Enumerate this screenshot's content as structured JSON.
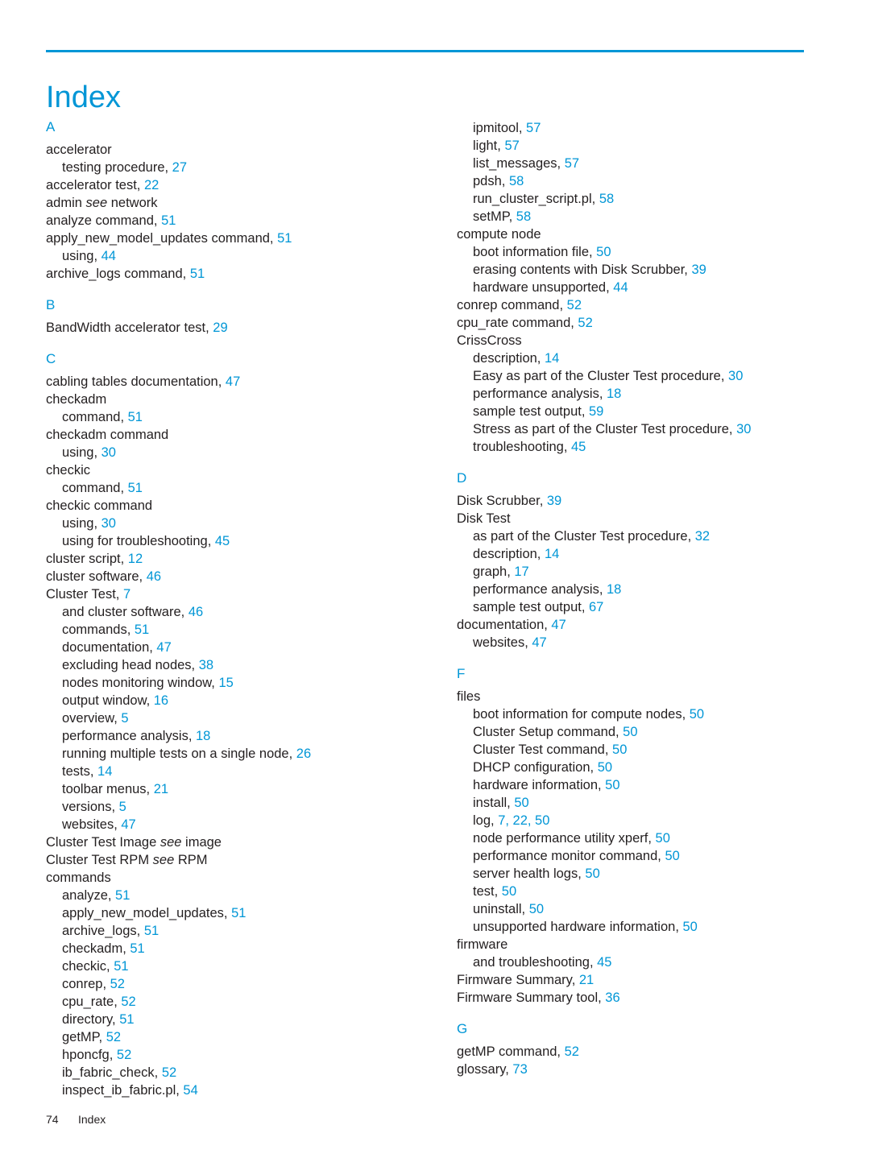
{
  "document": {
    "title": "Index",
    "footer": {
      "page_number": "74",
      "label": "Index"
    },
    "accent_color": "#0096d6",
    "text_color": "#231f20"
  },
  "columns": [
    {
      "sections": [
        {
          "letter": "A",
          "entries": [
            {
              "level": 1,
              "text": "accelerator",
              "page": ""
            },
            {
              "level": 2,
              "text": "testing procedure,",
              "page": "27"
            },
            {
              "level": 1,
              "text": "accelerator test,",
              "page": "22"
            },
            {
              "level": 1,
              "text": "admin ",
              "italic": "see",
              "text_after": " network",
              "page": ""
            },
            {
              "level": 1,
              "text": "analyze command,",
              "page": "51"
            },
            {
              "level": 1,
              "text": "apply_new_model_updates command,",
              "page": "51"
            },
            {
              "level": 2,
              "text": "using,",
              "page": "44"
            },
            {
              "level": 1,
              "text": "archive_logs command,",
              "page": "51"
            }
          ]
        },
        {
          "letter": "B",
          "entries": [
            {
              "level": 1,
              "text": "BandWidth accelerator test,",
              "page": "29"
            }
          ]
        },
        {
          "letter": "C",
          "entries": [
            {
              "level": 1,
              "text": "cabling tables documentation,",
              "page": "47"
            },
            {
              "level": 1,
              "text": "checkadm",
              "page": ""
            },
            {
              "level": 2,
              "text": "command,",
              "page": "51"
            },
            {
              "level": 1,
              "text": "checkadm command",
              "page": ""
            },
            {
              "level": 2,
              "text": "using,",
              "page": "30"
            },
            {
              "level": 1,
              "text": "checkic",
              "page": ""
            },
            {
              "level": 2,
              "text": "command,",
              "page": "51"
            },
            {
              "level": 1,
              "text": "checkic command",
              "page": ""
            },
            {
              "level": 2,
              "text": "using,",
              "page": "30"
            },
            {
              "level": 2,
              "text": "using for troubleshooting,",
              "page": "45"
            },
            {
              "level": 1,
              "text": "cluster script,",
              "page": "12"
            },
            {
              "level": 1,
              "text": "cluster software,",
              "page": "46"
            },
            {
              "level": 1,
              "text": "Cluster Test,",
              "page": "7"
            },
            {
              "level": 2,
              "text": "and cluster software,",
              "page": "46"
            },
            {
              "level": 2,
              "text": "commands,",
              "page": "51"
            },
            {
              "level": 2,
              "text": "documentation,",
              "page": "47"
            },
            {
              "level": 2,
              "text": "excluding head nodes,",
              "page": "38"
            },
            {
              "level": 2,
              "text": "nodes monitoring window,",
              "page": "15"
            },
            {
              "level": 2,
              "text": "output window,",
              "page": "16"
            },
            {
              "level": 2,
              "text": "overview,",
              "page": "5"
            },
            {
              "level": 2,
              "text": "performance analysis,",
              "page": "18"
            },
            {
              "level": 2,
              "text": "running multiple tests on a single node,",
              "page": "26"
            },
            {
              "level": 2,
              "text": "tests,",
              "page": "14"
            },
            {
              "level": 2,
              "text": "toolbar menus,",
              "page": "21"
            },
            {
              "level": 2,
              "text": "versions,",
              "page": "5"
            },
            {
              "level": 2,
              "text": "websites,",
              "page": "47"
            },
            {
              "level": 1,
              "text": "Cluster Test Image ",
              "italic": "see",
              "text_after": " image",
              "page": ""
            },
            {
              "level": 1,
              "text": "Cluster Test RPM ",
              "italic": "see",
              "text_after": " RPM",
              "page": ""
            },
            {
              "level": 1,
              "text": "commands",
              "page": ""
            },
            {
              "level": 2,
              "text": "analyze,",
              "page": "51"
            },
            {
              "level": 2,
              "text": "apply_new_model_updates,",
              "page": "51"
            },
            {
              "level": 2,
              "text": "archive_logs,",
              "page": "51"
            },
            {
              "level": 2,
              "text": "checkadm,",
              "page": "51"
            },
            {
              "level": 2,
              "text": "checkic,",
              "page": "51"
            },
            {
              "level": 2,
              "text": "conrep,",
              "page": "52"
            },
            {
              "level": 2,
              "text": "cpu_rate,",
              "page": "52"
            },
            {
              "level": 2,
              "text": "directory,",
              "page": "51"
            },
            {
              "level": 2,
              "text": "getMP,",
              "page": "52"
            },
            {
              "level": 2,
              "text": "hponcfg,",
              "page": "52"
            },
            {
              "level": 2,
              "text": "ib_fabric_check,",
              "page": "52"
            },
            {
              "level": 2,
              "text": "inspect_ib_fabric.pl,",
              "page": "54"
            }
          ]
        }
      ]
    },
    {
      "sections": [
        {
          "letter": "",
          "entries": [
            {
              "level": 2,
              "text": "ipmitool,",
              "page": "57"
            },
            {
              "level": 2,
              "text": "light,",
              "page": "57"
            },
            {
              "level": 2,
              "text": "list_messages,",
              "page": "57"
            },
            {
              "level": 2,
              "text": "pdsh,",
              "page": "58"
            },
            {
              "level": 2,
              "text": "run_cluster_script.pl,",
              "page": "58"
            },
            {
              "level": 2,
              "text": "setMP,",
              "page": "58"
            },
            {
              "level": 1,
              "text": "compute node",
              "page": ""
            },
            {
              "level": 2,
              "text": "boot information file,",
              "page": "50"
            },
            {
              "level": 2,
              "text": "erasing contents with Disk Scrubber,",
              "page": "39"
            },
            {
              "level": 2,
              "text": "hardware unsupported,",
              "page": "44"
            },
            {
              "level": 1,
              "text": "conrep command,",
              "page": "52"
            },
            {
              "level": 1,
              "text": "cpu_rate command,",
              "page": "52"
            },
            {
              "level": 1,
              "text": "CrissCross",
              "page": ""
            },
            {
              "level": 2,
              "text": "description,",
              "page": "14"
            },
            {
              "level": 2,
              "text": "Easy as part of the Cluster Test procedure,",
              "page": "30"
            },
            {
              "level": 2,
              "text": "performance analysis,",
              "page": "18"
            },
            {
              "level": 2,
              "text": "sample test output,",
              "page": "59"
            },
            {
              "level": 2,
              "text": "Stress as part of the Cluster Test procedure,",
              "page": "30"
            },
            {
              "level": 2,
              "text": "troubleshooting,",
              "page": "45"
            }
          ]
        },
        {
          "letter": "D",
          "entries": [
            {
              "level": 1,
              "text": "Disk Scrubber,",
              "page": "39"
            },
            {
              "level": 1,
              "text": "Disk Test",
              "page": ""
            },
            {
              "level": 2,
              "text": "as part of the Cluster Test procedure,",
              "page": "32"
            },
            {
              "level": 2,
              "text": "description,",
              "page": "14"
            },
            {
              "level": 2,
              "text": "graph,",
              "page": "17"
            },
            {
              "level": 2,
              "text": "performance analysis,",
              "page": "18"
            },
            {
              "level": 2,
              "text": "sample test output,",
              "page": "67"
            },
            {
              "level": 1,
              "text": "documentation,",
              "page": "47"
            },
            {
              "level": 2,
              "text": "websites,",
              "page": "47"
            }
          ]
        },
        {
          "letter": "F",
          "entries": [
            {
              "level": 1,
              "text": "files",
              "page": ""
            },
            {
              "level": 2,
              "text": "boot information for compute nodes,",
              "page": "50"
            },
            {
              "level": 2,
              "text": "Cluster Setup command,",
              "page": "50"
            },
            {
              "level": 2,
              "text": "Cluster Test command,",
              "page": "50"
            },
            {
              "level": 2,
              "text": "DHCP configuration,",
              "page": "50"
            },
            {
              "level": 2,
              "text": "hardware information,",
              "page": "50"
            },
            {
              "level": 2,
              "text": "install,",
              "page": "50"
            },
            {
              "level": 2,
              "text": "log,",
              "page": "7, 22, 50"
            },
            {
              "level": 2,
              "text": "node performance utility xperf,",
              "page": "50"
            },
            {
              "level": 2,
              "text": "performance monitor command,",
              "page": "50"
            },
            {
              "level": 2,
              "text": "server health logs,",
              "page": "50"
            },
            {
              "level": 2,
              "text": "test,",
              "page": "50"
            },
            {
              "level": 2,
              "text": "uninstall,",
              "page": "50"
            },
            {
              "level": 2,
              "text": "unsupported hardware information,",
              "page": "50"
            },
            {
              "level": 1,
              "text": "firmware",
              "page": ""
            },
            {
              "level": 2,
              "text": "and troubleshooting,",
              "page": "45"
            },
            {
              "level": 1,
              "text": "Firmware Summary,",
              "page": "21"
            },
            {
              "level": 1,
              "text": "Firmware Summary tool,",
              "page": "36"
            }
          ]
        },
        {
          "letter": "G",
          "entries": [
            {
              "level": 1,
              "text": "getMP command,",
              "page": "52"
            },
            {
              "level": 1,
              "text": "glossary,",
              "page": "73"
            }
          ]
        }
      ]
    }
  ]
}
